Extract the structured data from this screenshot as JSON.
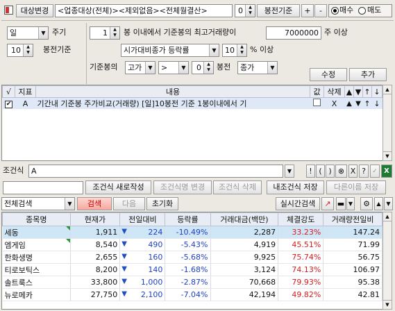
{
  "toolbar": {
    "target_change_label": "대상변경",
    "target_text": "<업종대상(전체)><제외없음><전체월결산>",
    "candle_value": "0",
    "candle_basis_label": "봉전기준",
    "plus": "+",
    "minus": "-",
    "buy_label": "매수",
    "sell_label": "매도"
  },
  "settings": {
    "period_value": "일",
    "period_label": "주기",
    "basis_value": "10",
    "basis_label": "봉전기준",
    "within_value": "1",
    "within_text": "봉 이내에서 기준봉의 최고거래량이",
    "volume_value": "7000000",
    "volume_suffix": "주 이상",
    "compare_value": "시가대비종가 등락률",
    "pct_value": "10",
    "pct_suffix": "% 이상",
    "ref_candle_label": "기준봉의",
    "ref_price": "고가",
    "ref_op": ">",
    "ref_offset": "0",
    "ref_offset_label": "봉전",
    "ref_target": "종가",
    "modify_label": "수정",
    "add_label": "추가"
  },
  "conditions": {
    "headers": [
      "√",
      "지표",
      "내용",
      "값",
      "삭제",
      "▲",
      "▼",
      "↑",
      "↓"
    ],
    "rows": [
      {
        "id": "A",
        "text": "기간내 기준봉 주가비교(거래량) [일]10봉전 기준 1봉이내에서 기",
        "delete": "X"
      }
    ]
  },
  "formula": {
    "label": "조건식",
    "value": "A",
    "ops": [
      "!",
      "(",
      ")",
      "X",
      "?"
    ]
  },
  "actions": {
    "quick_create": "조건식 새로작성",
    "rename": "조건식명 변경",
    "delete": "조건식 삭제",
    "my_save": "내조건식 저장",
    "save_as": "다른이름 저장"
  },
  "search": {
    "scope": "전체검색",
    "search_btn": "검색",
    "next_btn": "다음",
    "reset_btn": "초기화",
    "realtime_btn": "실시간검색"
  },
  "results": {
    "headers": [
      "종목명",
      "현재가",
      "전일대비",
      "등락률",
      "거래대금(백만)",
      "체결강도",
      "거래량전일비"
    ],
    "rows": [
      {
        "name": "세동",
        "price": "1,911",
        "change": "224",
        "rate": "-10.49%",
        "amount": "2,287",
        "strength": "33.23%",
        "vol": "147.24",
        "flag": true
      },
      {
        "name": "엠게임",
        "price": "8,540",
        "change": "490",
        "rate": "-5.43%",
        "amount": "4,919",
        "strength": "45.51%",
        "vol": "71.99",
        "flag": true
      },
      {
        "name": "한화생명",
        "price": "2,655",
        "change": "160",
        "rate": "-5.68%",
        "amount": "9,925",
        "strength": "75.74%",
        "vol": "56.75",
        "flag": false
      },
      {
        "name": "티로보틱스",
        "price": "8,200",
        "change": "140",
        "rate": "-1.68%",
        "amount": "3,124",
        "strength": "74.13%",
        "vol": "106.97",
        "flag": false
      },
      {
        "name": "솔트룩스",
        "price": "33,800",
        "change": "1,000",
        "rate": "-2.87%",
        "amount": "70,668",
        "strength": "79.93%",
        "vol": "95.38",
        "flag": false
      },
      {
        "name": "뉴로메카",
        "price": "27,750",
        "change": "2,100",
        "rate": "-7.04%",
        "amount": "42,194",
        "strength": "49.82%",
        "vol": "42.81",
        "flag": false
      }
    ]
  },
  "colors": {
    "down": "#1f3fbf",
    "up": "#d02020",
    "selected_row": "#cfe6f7"
  }
}
